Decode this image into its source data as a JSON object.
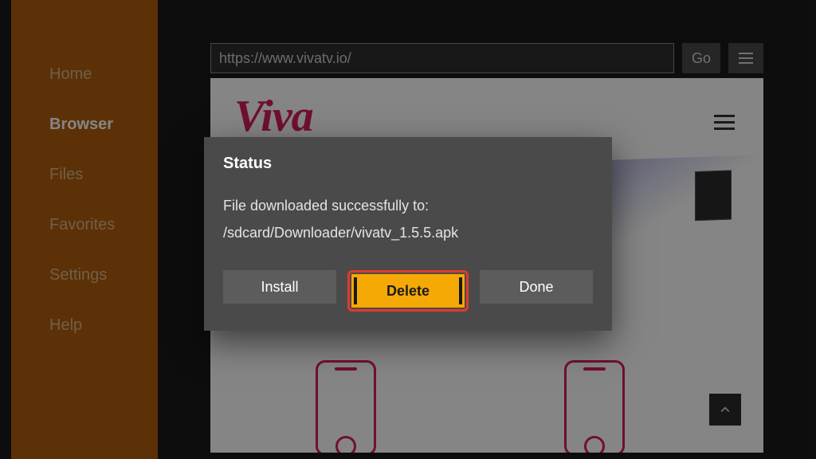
{
  "sidebar": {
    "items": [
      {
        "label": "Home"
      },
      {
        "label": "Browser"
      },
      {
        "label": "Files"
      },
      {
        "label": "Favorites"
      },
      {
        "label": "Settings"
      },
      {
        "label": "Help"
      }
    ],
    "active_index": 1
  },
  "browser": {
    "url": "https://www.vivatv.io/",
    "go_label": "Go",
    "site_logo_text": "Viva"
  },
  "dialog": {
    "title": "Status",
    "message": "File downloaded successfully to:",
    "path": "/sdcard/Downloader/vivatv_1.5.5.apk",
    "buttons": {
      "install": "Install",
      "delete": "Delete",
      "done": "Done"
    },
    "highlighted": "delete"
  },
  "colors": {
    "sidebar_bg": "#b15f0e",
    "accent_site": "#d81e5b",
    "highlight_btn": "#f5a905",
    "highlight_ring": "#e03a2f"
  }
}
